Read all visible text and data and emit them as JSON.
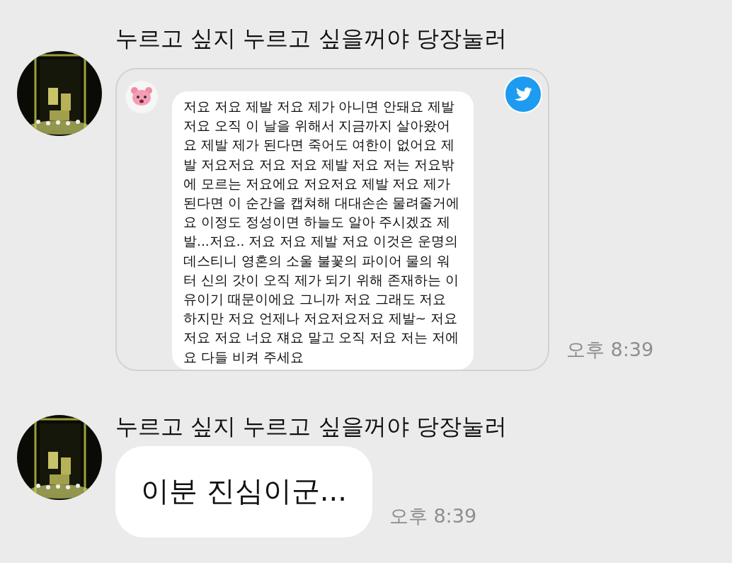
{
  "messages": [
    {
      "kind": "tweet",
      "sender": "누르고 싶지 누르고 싶을꺼야 당장눌러",
      "tweet_text": "저요 저요 제발 저요 제가 아니면 안돼요 제발 저요 오직 이 날을 위해서 지금까지 살아왔어요 제발 제가 된다면 죽어도 여한이 없어요 제발 저요저요 저요 저요 제발 저요 저는 저요밖에 모르는 저요에요 저요저요 제발 저요 제가 된다면 이 순간을 캡쳐해 대대손손 물려줄거에요 이정도 정성이면 하늘도 알아 주시겠죠 제발...저요.. 저요 저요 제발 저요 이것은 운명의 데스티니 영혼의 소울 불꽃의 파이어 물의 워터 신의 갓이 오직 제가 되기 위해 존재하는 이유이기 때문이에요 그니까 저요 그래도 저요 하지만 저요 언제나 저요저요저요 제발~ 저요 저요 저요 너요 쟤요 말고 오직 저요 저는 저에요 다들 비켜 주세요",
      "time": "오후 8:39"
    },
    {
      "kind": "text",
      "sender": "누르고 싶지 누르고 싶을꺼야 당장눌러",
      "text": "이분 진심이군...",
      "time": "오후 8:39"
    }
  ]
}
